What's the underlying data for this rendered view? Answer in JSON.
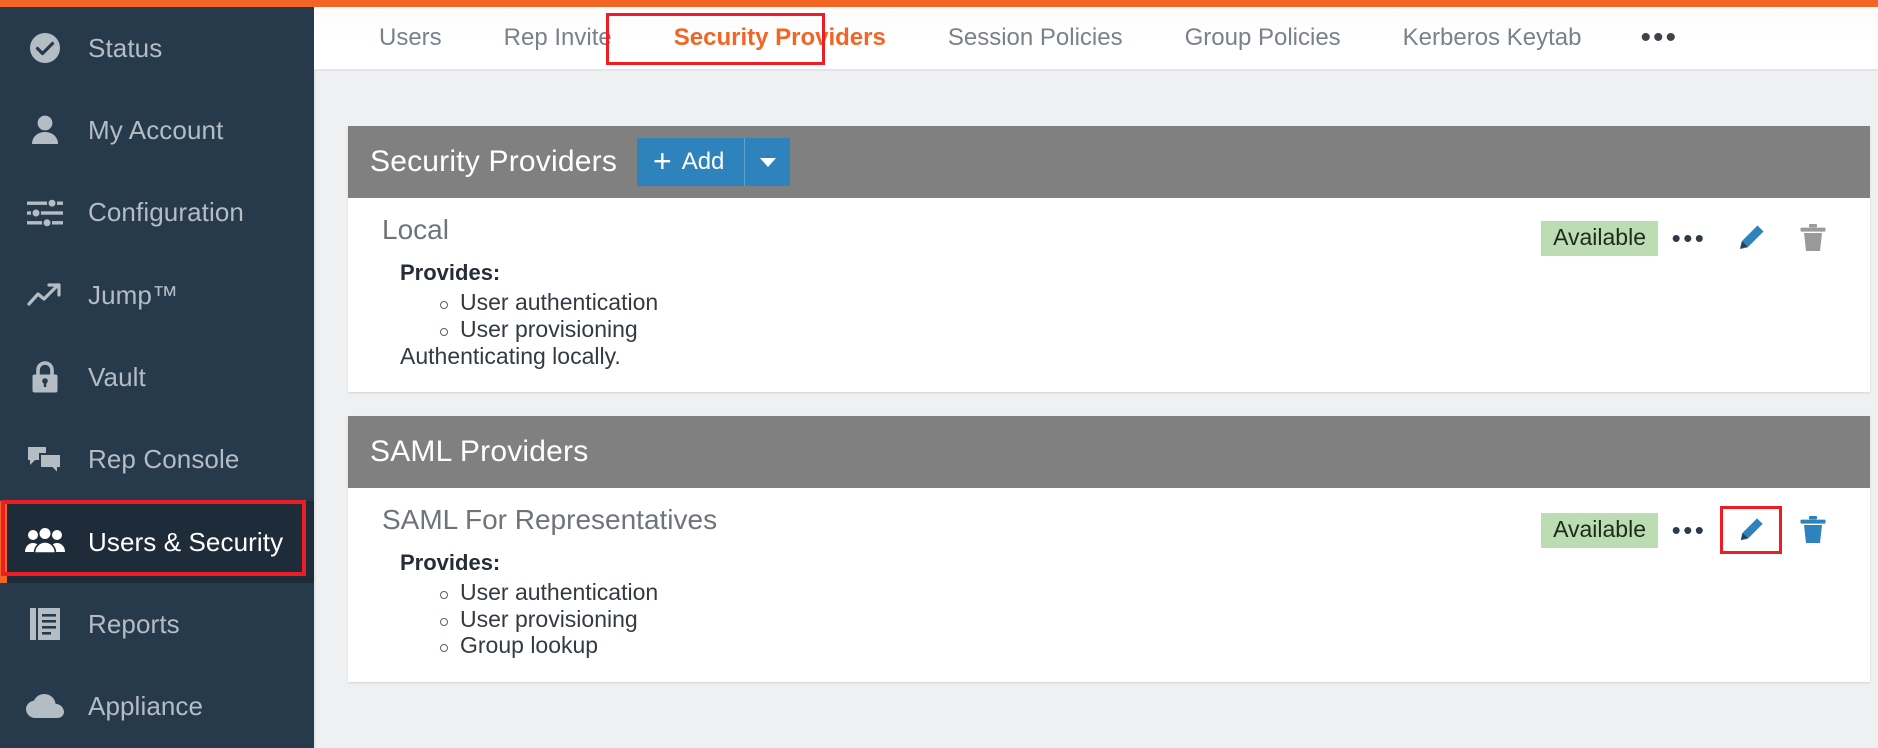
{
  "brand": {
    "accent_orange": "#f26524",
    "accent_blue": "#2e83bd",
    "highlight_red": "#ee1c25",
    "panel_gray": "#808080",
    "badge_green": "#bcdcb4"
  },
  "sidebar": {
    "items": [
      {
        "label": "Status",
        "icon": "check-circle-icon",
        "active": false
      },
      {
        "label": "My Account",
        "icon": "user-icon",
        "active": false
      },
      {
        "label": "Configuration",
        "icon": "sliders-icon",
        "active": false
      },
      {
        "label": "Jump™",
        "icon": "trend-arrow-icon",
        "active": false
      },
      {
        "label": "Vault",
        "icon": "lock-icon",
        "active": false
      },
      {
        "label": "Rep Console",
        "icon": "chat-bubbles-icon",
        "active": false
      },
      {
        "label": "Users & Security",
        "icon": "users-group-icon",
        "active": true
      },
      {
        "label": "Reports",
        "icon": "report-document-icon",
        "active": false
      },
      {
        "label": "Appliance",
        "icon": "cloud-icon",
        "active": false
      }
    ]
  },
  "tabs": {
    "items": [
      {
        "label": "Users",
        "active": false
      },
      {
        "label": "Rep Invite",
        "active": false
      },
      {
        "label": "Security Providers",
        "active": true
      },
      {
        "label": "Session Policies",
        "active": false
      },
      {
        "label": "Group Policies",
        "active": false
      },
      {
        "label": "Kerberos Keytab",
        "active": false
      }
    ],
    "more_label": "•••"
  },
  "panels": [
    {
      "title": "Security Providers",
      "add_label": "Add",
      "add_plus": "+",
      "has_add": true,
      "providers": [
        {
          "name": "Local",
          "provides_label": "Provides:",
          "provides": [
            "User authentication",
            "User provisioning"
          ],
          "note": "Authenticating locally.",
          "status": "Available",
          "menu_label": "•••",
          "edit_icon": "pencil-icon",
          "delete_icon": "trash-icon",
          "edit_highlighted": false,
          "edit_color": "#2e83bd",
          "delete_color": "#9a9a9a"
        }
      ]
    },
    {
      "title": "SAML Providers",
      "has_add": false,
      "providers": [
        {
          "name": "SAML For Representatives",
          "provides_label": "Provides:",
          "provides": [
            "User authentication",
            "User provisioning",
            "Group lookup"
          ],
          "note": "",
          "status": "Available",
          "menu_label": "•••",
          "edit_icon": "pencil-icon",
          "delete_icon": "trash-icon",
          "edit_highlighted": true,
          "edit_color": "#2e83bd",
          "delete_color": "#2e83bd"
        }
      ]
    }
  ]
}
